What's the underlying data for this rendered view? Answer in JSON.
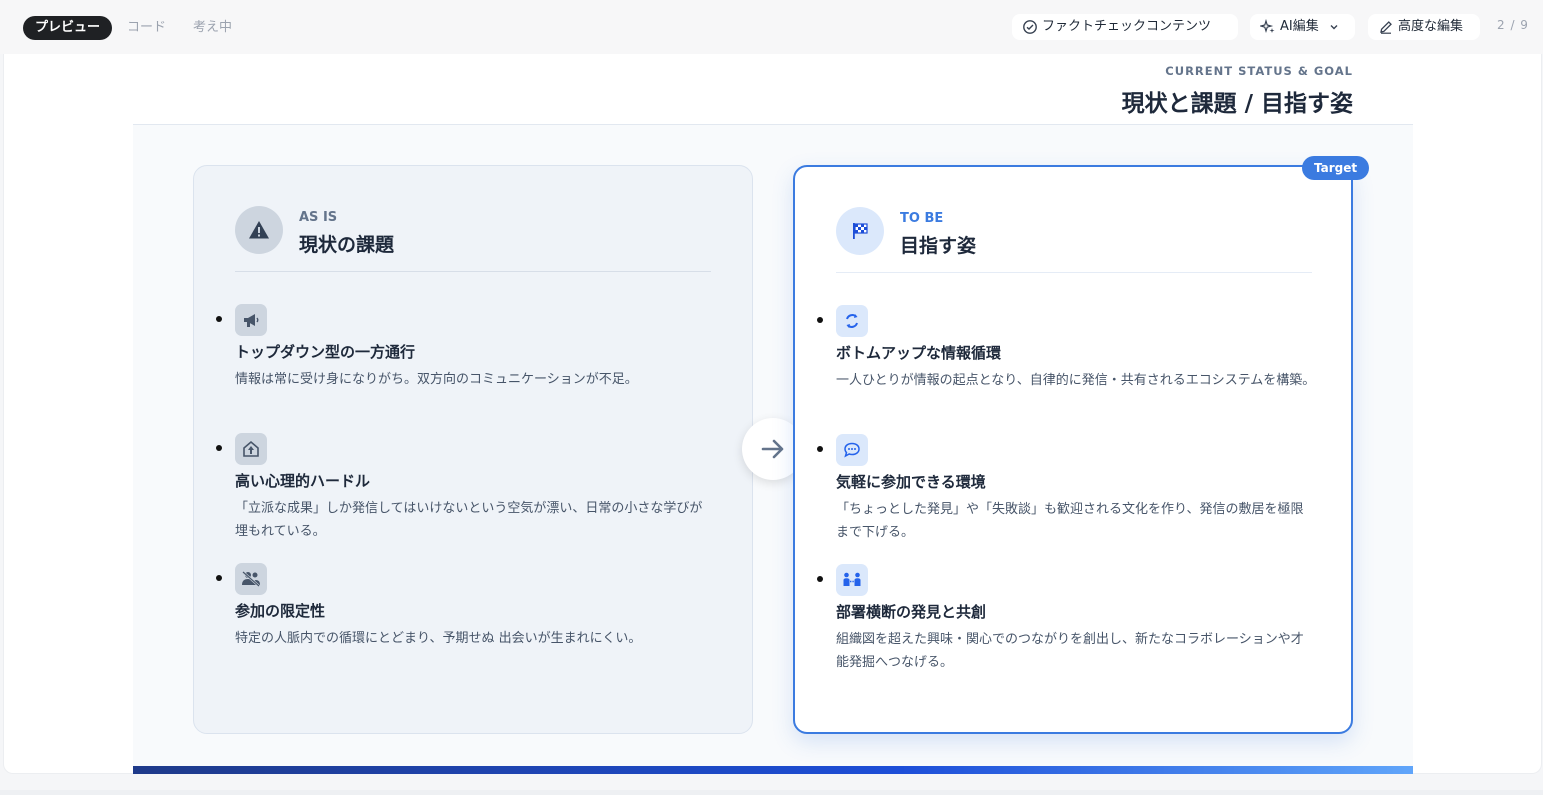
{
  "toolbar": {
    "tabs": [
      {
        "label": "プレビュー"
      },
      {
        "label": "コード"
      },
      {
        "label": "考え中"
      }
    ],
    "fact_check_label": "ファクトチェックコンテンツ",
    "ai_edit_label": "AI編集",
    "advanced_edit_label": "高度な編集",
    "page_indicator": "2 / 9"
  },
  "slide": {
    "eyebrow": "CURRENT STATUS & GOAL",
    "title": "現状と課題 / 目指す姿",
    "target_badge": "Target",
    "as_is": {
      "eyebrow": "AS IS",
      "title": "現状の課題",
      "items": [
        {
          "icon": "megaphone-icon",
          "title": "トップダウン型の一方通行",
          "desc": "情報は常に受け身になりがち。双方向のコミュニケーションが不足。"
        },
        {
          "icon": "hurdle-icon",
          "title": "高い心理的ハードル",
          "desc": "「立派な成果」しか発信してはいけないという空気が漂い、日常の小さな学びが埋もれている。"
        },
        {
          "icon": "users-slash-icon",
          "title": "参加の限定性",
          "desc": "特定の人脈内での循環にとどまり、予期せぬ 出会いが生まれにくい。"
        }
      ]
    },
    "to_be": {
      "eyebrow": "TO BE",
      "title": "目指す姿",
      "items": [
        {
          "icon": "recycle-icon",
          "title": "ボトムアップな情報循環",
          "desc": "一人ひとりが情報の起点となり、自律的に発信・共有されるエコシステムを構築。"
        },
        {
          "icon": "chat-icon",
          "title": "気軽に参加できる環境",
          "desc": "「ちょっとした発見」や「失敗談」も歓迎される文化を作り、発信の敷居を極限まで下げる。"
        },
        {
          "icon": "people-connect-icon",
          "title": "部署横断の発見と共創",
          "desc": "組織図を超えた興味・関心でのつながりを創出し、新たなコラボレーションや才能発掘へつなげる。"
        }
      ]
    }
  },
  "colors": {
    "accent": "#3b7be0",
    "asis_bg": "#eff3f8",
    "dark_tab": "#1f2124"
  }
}
